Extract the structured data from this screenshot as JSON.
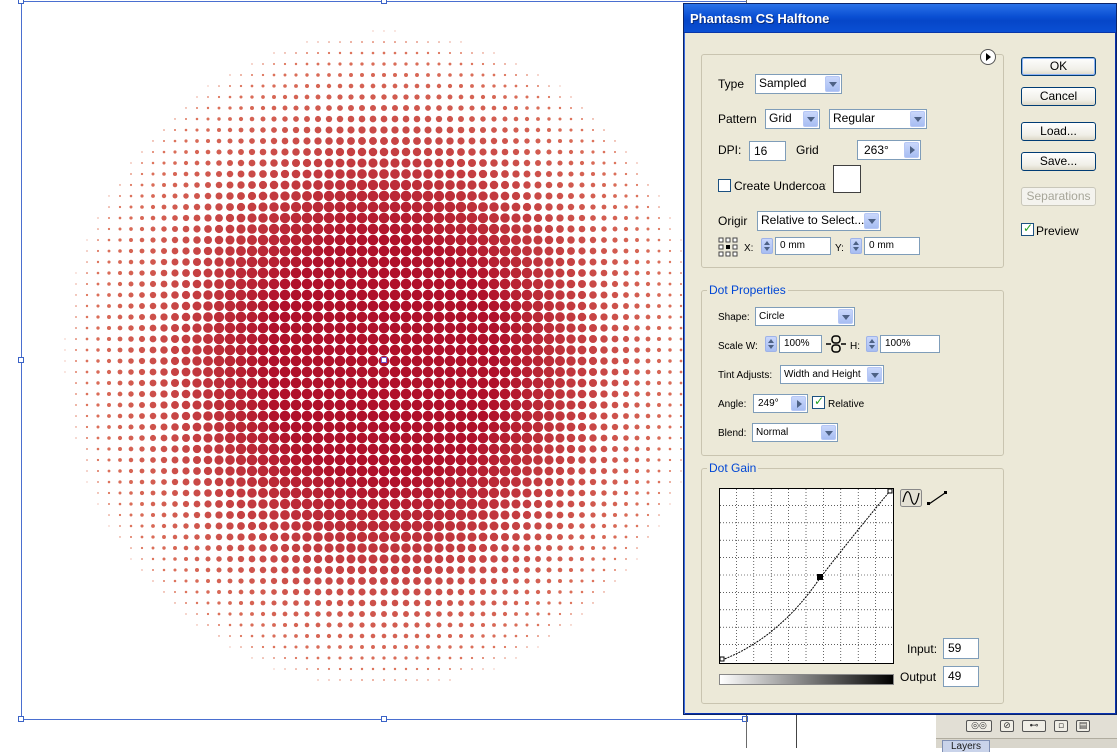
{
  "dialog": {
    "title": "Phantasm CS Halftone",
    "type": {
      "label": "Type",
      "value": "Sampled"
    },
    "pattern": {
      "label": "Pattern",
      "value": "Grid",
      "style_value": "Regular"
    },
    "dpi": {
      "label": "DPI:",
      "value": "16"
    },
    "grid": {
      "label": "Grid",
      "value": "263°"
    },
    "undercoat": {
      "label": "Create Undercoat",
      "checked": false
    },
    "origin": {
      "label": "Origir",
      "value": "Relative to Select...",
      "x_label": "X:",
      "x_value": "0 mm",
      "y_label": "Y:",
      "y_value": "0 mm"
    },
    "dot_properties": {
      "legend": "Dot Properties",
      "shape_label": "Shape:",
      "shape_value": "Circle",
      "scale_label": "Scale W:",
      "scale_w": "100%",
      "scale_h_label": "H:",
      "scale_h": "100%",
      "tint_label": "Tint Adjusts:",
      "tint_value": "Width and Height",
      "angle_label": "Angle:",
      "angle_value": "249°",
      "relative_label": "Relative",
      "relative_checked": true,
      "blend_label": "Blend:",
      "blend_value": "Normal"
    },
    "dot_gain": {
      "legend": "Dot Gain",
      "input_label": "Input:",
      "input_value": "59",
      "output_label": "Output",
      "output_value": "49"
    },
    "buttons": {
      "ok": "OK",
      "cancel": "Cancel",
      "load": "Load...",
      "save": "Save...",
      "separations": "Separations"
    },
    "preview": {
      "label": "Preview",
      "checked": true
    }
  },
  "layers_panel": {
    "tab": "Layers"
  },
  "colors": {
    "dot_center": "#b0102a",
    "dot_edge": "#e07a5f",
    "title_bar": "#0a4fd3",
    "legend_text": "#0046d5"
  }
}
